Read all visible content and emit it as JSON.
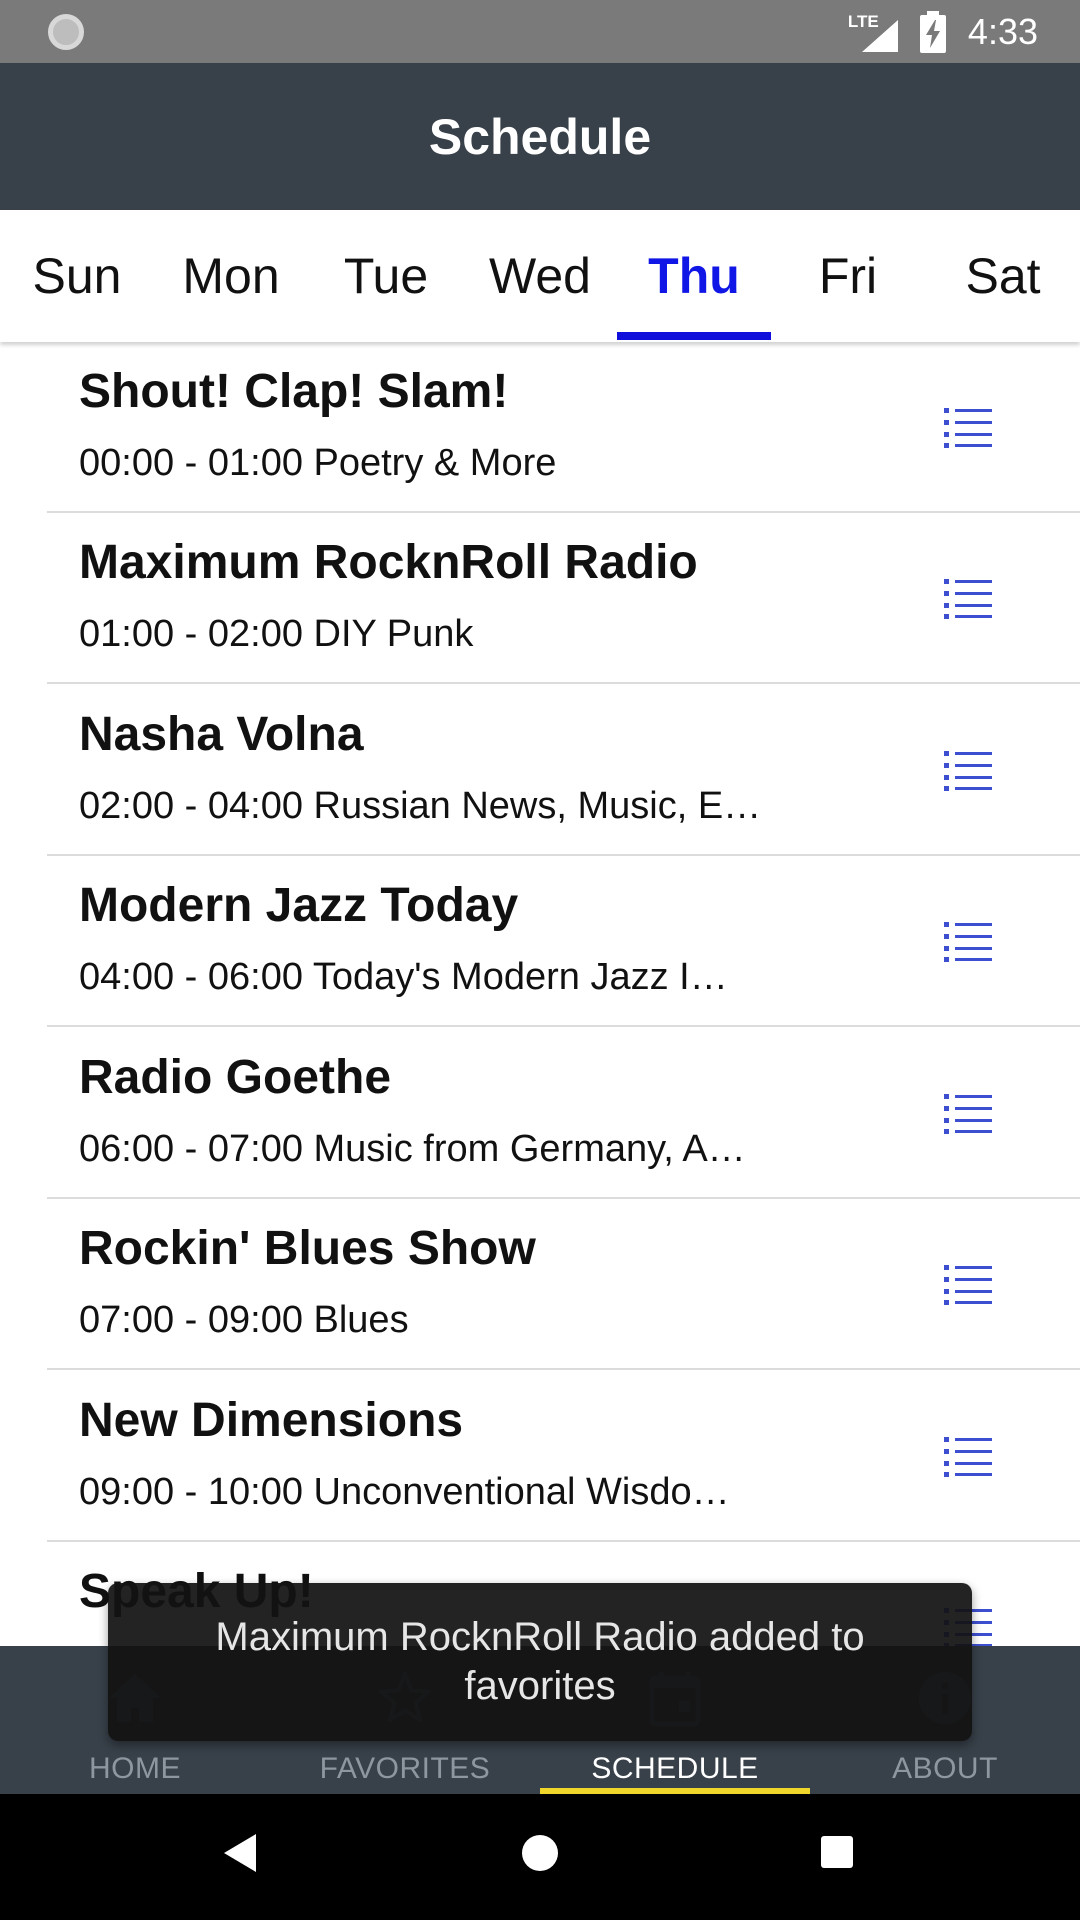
{
  "status_bar": {
    "network_label": "LTE",
    "time": "4:33"
  },
  "app_bar": {
    "title": "Schedule"
  },
  "day_tabs": [
    {
      "label": "Sun"
    },
    {
      "label": "Mon"
    },
    {
      "label": "Tue"
    },
    {
      "label": "Wed"
    },
    {
      "label": "Thu",
      "selected": true
    },
    {
      "label": "Fri"
    },
    {
      "label": "Sat"
    }
  ],
  "shows": [
    {
      "name": "Shout! Clap! Slam!",
      "info": "00:00 - 01:00 Poetry & More"
    },
    {
      "name": "Maximum RocknRoll Radio",
      "info": "01:00 - 02:00 DIY Punk"
    },
    {
      "name": "Nasha Volna",
      "info": "02:00 - 04:00 Russian News, Music, E…"
    },
    {
      "name": "Modern Jazz Today",
      "info": "04:00 - 06:00 Today's Modern Jazz I…"
    },
    {
      "name": "Radio Goethe",
      "info": "06:00 - 07:00 Music from Germany, A…"
    },
    {
      "name": "Rockin' Blues Show",
      "info": "07:00 - 09:00 Blues"
    },
    {
      "name": "New Dimensions",
      "info": "09:00 - 10:00 Unconventional Wisdo…"
    },
    {
      "name": "Speak Up!",
      "info": ""
    }
  ],
  "bottom_nav": [
    {
      "label": "HOME",
      "icon": "home-icon"
    },
    {
      "label": "FAVORITES",
      "icon": "star-icon"
    },
    {
      "label": "SCHEDULE",
      "icon": "calendar-icon",
      "selected": true
    },
    {
      "label": "ABOUT",
      "icon": "info-icon"
    }
  ],
  "snackbar": {
    "message": "Maximum RocknRoll Radio added to favorites"
  },
  "colors": {
    "app_bar": "#384049",
    "selected_tab": "#1016e6",
    "nav_indicator": "#f0d52a",
    "list_icon": "#3c4fd0"
  }
}
